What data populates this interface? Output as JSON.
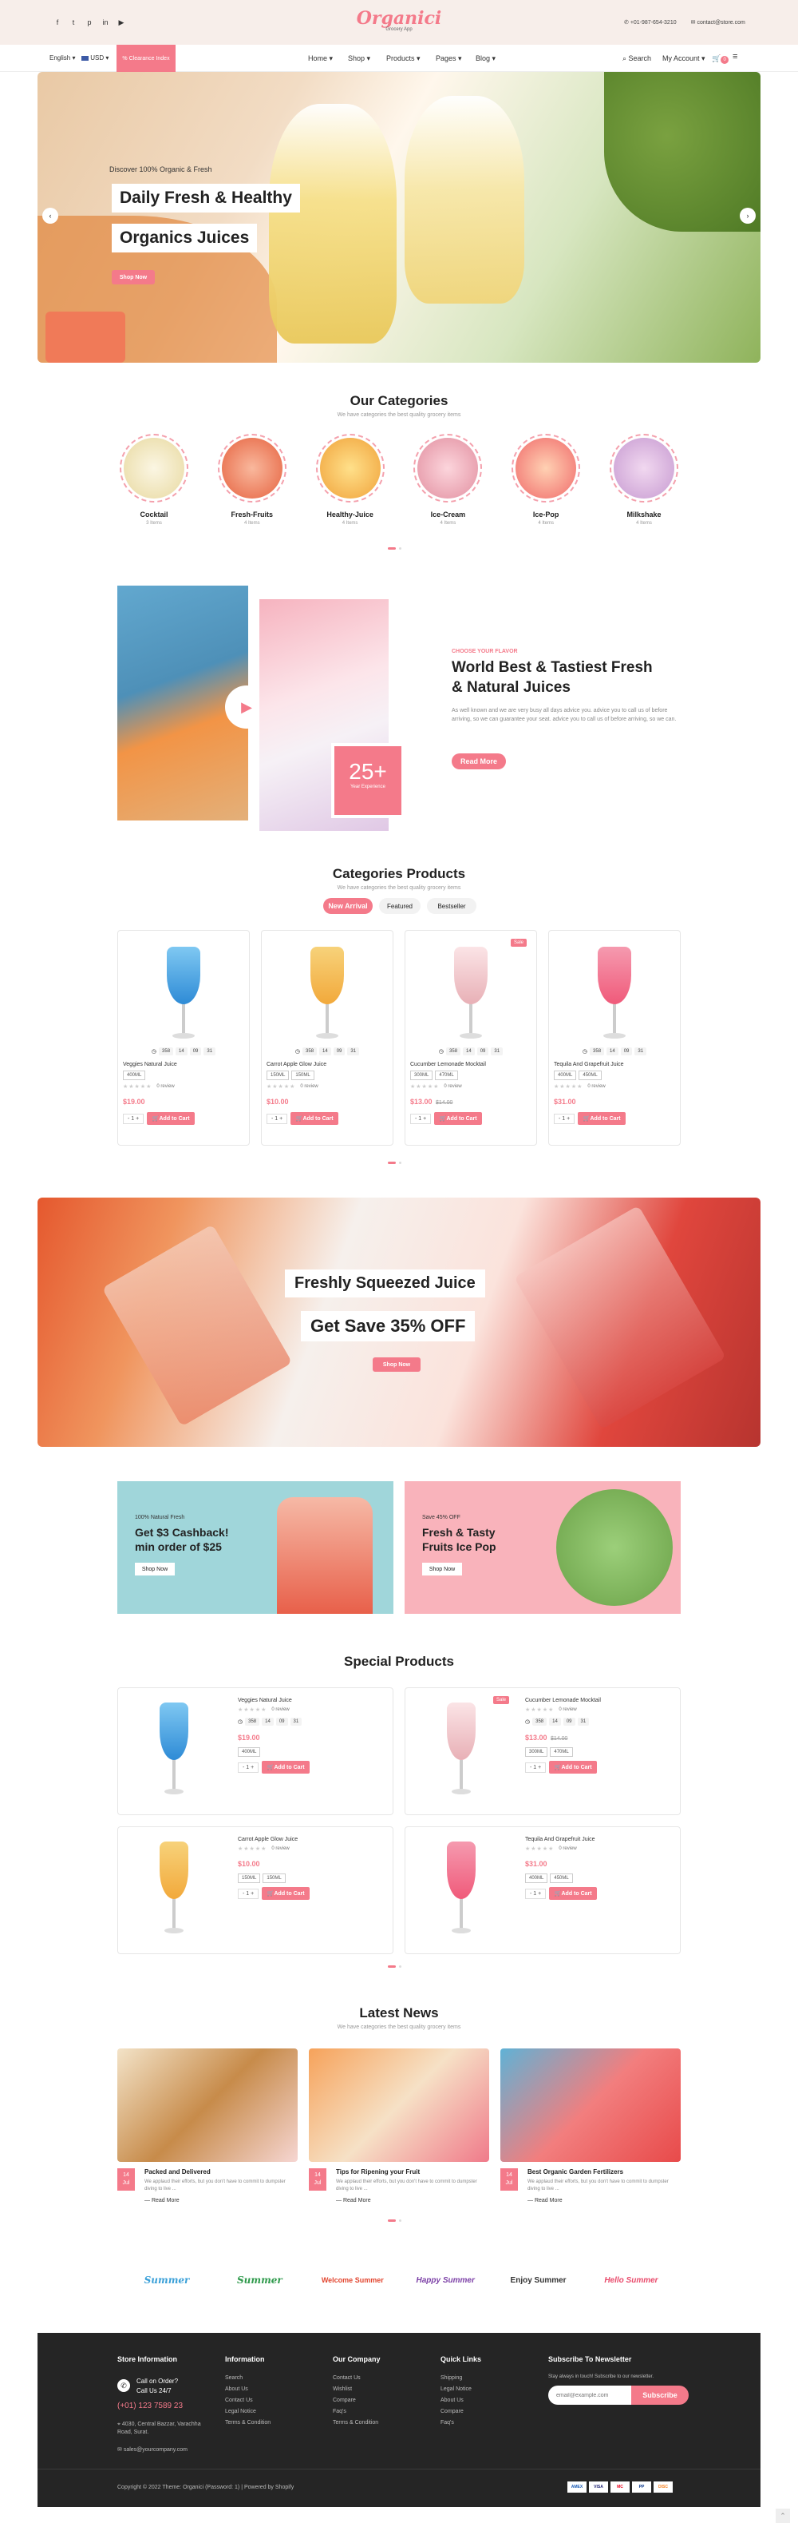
{
  "topbar": {
    "logo": "Organici",
    "logo_sub": "Grocery App",
    "phone": "+01-987-654-3210",
    "email": "contact@store.com"
  },
  "nav": {
    "lang": "English",
    "currency": "USD",
    "offer_btn": "% Clearance Index",
    "links": [
      "Home",
      "Shop",
      "Products",
      "Pages",
      "Blog"
    ],
    "search": "Search",
    "account": "My Account",
    "cart_count": "0"
  },
  "hero": {
    "kicker": "Discover 100% Organic & Fresh",
    "line1": "Daily Fresh & Healthy",
    "line2": "Organics Juices",
    "cta": "Shop Now"
  },
  "categories": {
    "title": "Our Categories",
    "subtitle": "We have categories the best quality grocery items",
    "items": [
      {
        "name": "Cocktail",
        "count": "3 Items"
      },
      {
        "name": "Fresh-Fruits",
        "count": "4 Items"
      },
      {
        "name": "Healthy-Juice",
        "count": "4 Items"
      },
      {
        "name": "Ice-Cream",
        "count": "4 Items"
      },
      {
        "name": "Ice-Pop",
        "count": "4 Items"
      },
      {
        "name": "Milkshake",
        "count": "4 Items"
      }
    ]
  },
  "about": {
    "kicker": "CHOOSE YOUR FLAVOR",
    "title_l1": "World Best & Tastiest Fresh",
    "title_l2": "& Natural Juices",
    "body": "As well known and we are very busy all days advice you. advice you to call us of before arriving, so we can guarantee your seat. advice you to call us of before arriving, so we can.",
    "cta": "Read More",
    "years": "25+",
    "years_label": "Year Experience"
  },
  "cat_products": {
    "title": "Categories Products",
    "subtitle": "We have categories the best quality grocery items",
    "tabs": [
      "New Arrival",
      "Featured",
      "Bestseller"
    ],
    "items": [
      {
        "name": "Veggies Natural Juice",
        "sizes": [
          "400ML"
        ],
        "price": "$19.00",
        "old": "",
        "badge": ""
      },
      {
        "name": "Carrot Apple Glow Juice",
        "sizes": [
          "150ML",
          "150ML"
        ],
        "price": "$10.00",
        "old": "",
        "badge": ""
      },
      {
        "name": "Cucumber Lemonade Mocktail",
        "sizes": [
          "300ML",
          "470ML"
        ],
        "price": "$13.00",
        "old": "$14.00",
        "badge": "Sale"
      },
      {
        "name": "Tequila And Grapefruit Juice",
        "sizes": [
          "400ML",
          "450ML"
        ],
        "price": "$31.00",
        "old": "",
        "badge": ""
      }
    ],
    "countdown": [
      "358",
      "14",
      "09",
      "31"
    ],
    "review": "0 review",
    "add_to_cart": "Add to Cart"
  },
  "promo_banner": {
    "line1": "Freshly Squeezed Juice",
    "line2": "Get Save 35% OFF",
    "cta": "Shop Now"
  },
  "offers": [
    {
      "kicker": "100% Natural Fresh",
      "title_l1": "Get $3 Cashback!",
      "title_l2": "min order of $25",
      "cta": "Shop Now"
    },
    {
      "kicker": "Save 45% OFF",
      "title_l1": "Fresh & Tasty",
      "title_l2": "Fruits Ice Pop",
      "cta": "Shop Now"
    }
  ],
  "special": {
    "title": "Special Products",
    "items": [
      {
        "name": "Veggies Natural Juice",
        "price": "$19.00",
        "old": "",
        "sizes": [
          "400ML"
        ],
        "badge": ""
      },
      {
        "name": "Cucumber Lemonade Mocktail",
        "price": "$13.00",
        "old": "$14.00",
        "sizes": [
          "300ML",
          "470ML"
        ],
        "badge": "Sale"
      },
      {
        "name": "Carrot Apple Glow Juice",
        "price": "$10.00",
        "old": "",
        "sizes": [
          "150ML",
          "150ML"
        ],
        "badge": ""
      },
      {
        "name": "Tequila And Grapefruit Juice",
        "price": "$31.00",
        "old": "",
        "sizes": [
          "400ML",
          "450ML"
        ],
        "badge": ""
      }
    ]
  },
  "news": {
    "title": "Latest News",
    "subtitle": "We have categories the best quality grocery items",
    "items": [
      {
        "day": "14",
        "mon": "Jul",
        "title": "Packed and Delivered",
        "excerpt": "We applaud their efforts, but you don't have to commit to dumpster diving to live ...",
        "more": "Read More"
      },
      {
        "day": "14",
        "mon": "Jul",
        "title": "Tips for Ripening your Fruit",
        "excerpt": "We applaud their efforts, but you don't have to commit to dumpster diving to live ...",
        "more": "Read More"
      },
      {
        "day": "14",
        "mon": "Jul",
        "title": "Best Organic Garden Fertilizers",
        "excerpt": "We applaud their efforts, but you don't have to commit to dumpster diving to live ...",
        "more": "Read More"
      }
    ]
  },
  "brands": [
    "Summer",
    "Summer",
    "Welcome Summer",
    "Happy Summer",
    "Enjoy Summer",
    "Hello Summer"
  ],
  "footer": {
    "store_title": "Store Information",
    "call_l1": "Call on Order?",
    "call_l2": "Call Us 24/7",
    "phone": "(+01) 123 7589 23",
    "address": "4030, Central Bazzar, Varachha Road, Surat.",
    "email": "sales@yourcompany.com",
    "col2_title": "Information",
    "col2": [
      "Search",
      "About Us",
      "Contact Us",
      "Legal Notice",
      "Terms & Condition"
    ],
    "col3_title": "Our Company",
    "col3": [
      "Contact Us",
      "Wishlist",
      "Compare",
      "Faq's",
      "Terms & Condition"
    ],
    "col4_title": "Quick Links",
    "col4": [
      "Shipping",
      "Legal Notice",
      "About Us",
      "Compare",
      "Faq's"
    ],
    "news_title": "Subscribe To Newsletter",
    "news_text": "Stay always in touch! Subscribe to our newsletter.",
    "news_placeholder": "email@example.com",
    "news_btn": "Subscribe",
    "copyright": "Copyright © 2022 Theme: Organici (Password: 1) | Powered by Shopify",
    "payments": [
      "AMEX",
      "VISA",
      "MC",
      "PP",
      "DISC"
    ]
  }
}
